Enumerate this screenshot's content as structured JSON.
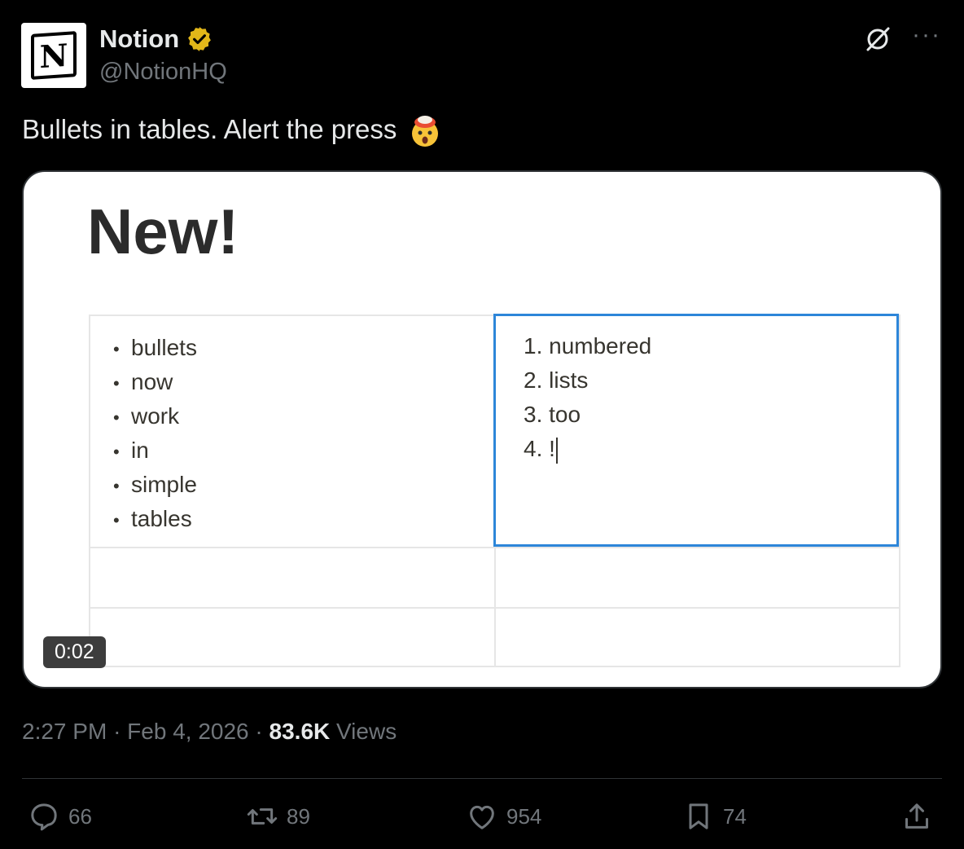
{
  "author": {
    "name": "Notion",
    "handle": "@NotionHQ",
    "avatar_letter": "N"
  },
  "tweet": {
    "text": "Bullets in tables. Alert the press",
    "emoji": "exploding-head"
  },
  "media": {
    "headline": "New!",
    "bullets": [
      "bullets",
      "now",
      "work",
      "in",
      "simple",
      "tables"
    ],
    "numbered": [
      "1. numbered",
      "2. lists",
      "3. too",
      "4. !"
    ],
    "duration": "0:02"
  },
  "meta": {
    "time": "2:27 PM",
    "separator1": "·",
    "date": "Feb 4, 2026",
    "separator2": "·",
    "views_count": "83.6K",
    "views_label": "Views"
  },
  "actions": {
    "replies": "66",
    "reposts": "89",
    "likes": "954",
    "bookmarks": "74"
  },
  "colors": {
    "background": "#000000",
    "verified_badge": "#e2b719",
    "selection_border": "#2d86d9",
    "muted": "#71767b"
  }
}
